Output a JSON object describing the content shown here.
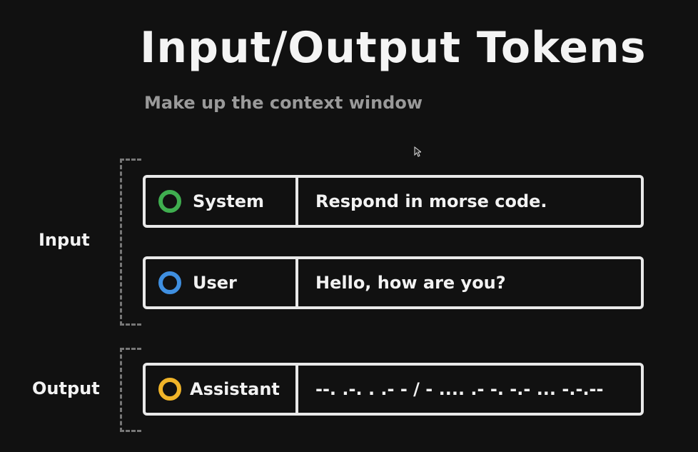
{
  "title": "Input/Output Tokens",
  "subtitle": "Make up the context window",
  "groups": {
    "input": "Input",
    "output": "Output"
  },
  "messages": [
    {
      "role": "System",
      "content": "Respond in morse code.",
      "color": "#3fae4f"
    },
    {
      "role": "User",
      "content": "Hello, how are you?",
      "color": "#3f8fe0"
    },
    {
      "role": "Assistant",
      "content": "--. .-. . .- - / - .... .- -. -.- ... -.-.--",
      "color": "#f0b429"
    }
  ]
}
